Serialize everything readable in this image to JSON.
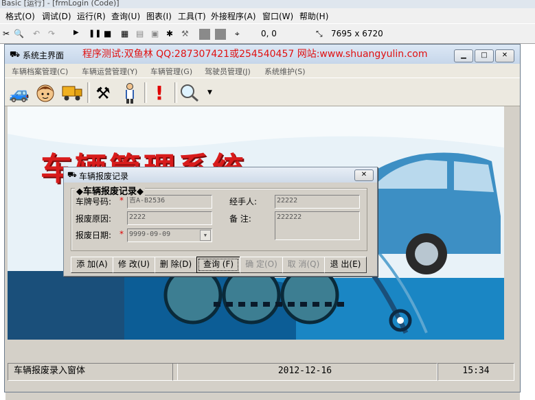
{
  "ide": {
    "title": "Basic [运行] - [frmLogin (Code)]",
    "menu": [
      "格式(O)",
      "调试(D)",
      "运行(R)",
      "查询(U)",
      "图表(I)",
      "工具(T)",
      "外接程序(A)",
      "窗口(W)",
      "帮助(H)"
    ],
    "coords": "0, 0",
    "size": "7695 x 6720"
  },
  "main_form": {
    "title": "系统主界面",
    "banner": "程序测试:双鱼林 QQ:287307421或254540457 网站:www.shuangyulin.com",
    "menu": [
      "车辆档案管理(C)",
      "车辆运营管理(Y)",
      "车辆管理(G)",
      "驾驶员管理(J)",
      "系统维护(S)"
    ],
    "picture_title": "车辆管理系统",
    "status": {
      "message": "车辆报废录入窗体",
      "date": "2012-12-16",
      "time": "15:34"
    }
  },
  "dialog": {
    "title": "车辆报废记录",
    "group_label": "◆车辆报废记录◆",
    "fields": {
      "plate_label": "车牌号码:",
      "plate_value": "吉A-B2536",
      "reason_label": "报废原因:",
      "reason_value": "2222",
      "date_label": "报废日期:",
      "date_value": "9999-09-09",
      "handler_label": "经手人:",
      "handler_value": "22222",
      "remark_label": "备  注:",
      "remark_value": "222222"
    },
    "required_mark": "*",
    "buttons": [
      "添 加(A)",
      "修 改(U)",
      "删 除(D)",
      "查询 (F)",
      "确 定(O)",
      "取 消(Q)",
      "退 出(E)"
    ]
  }
}
